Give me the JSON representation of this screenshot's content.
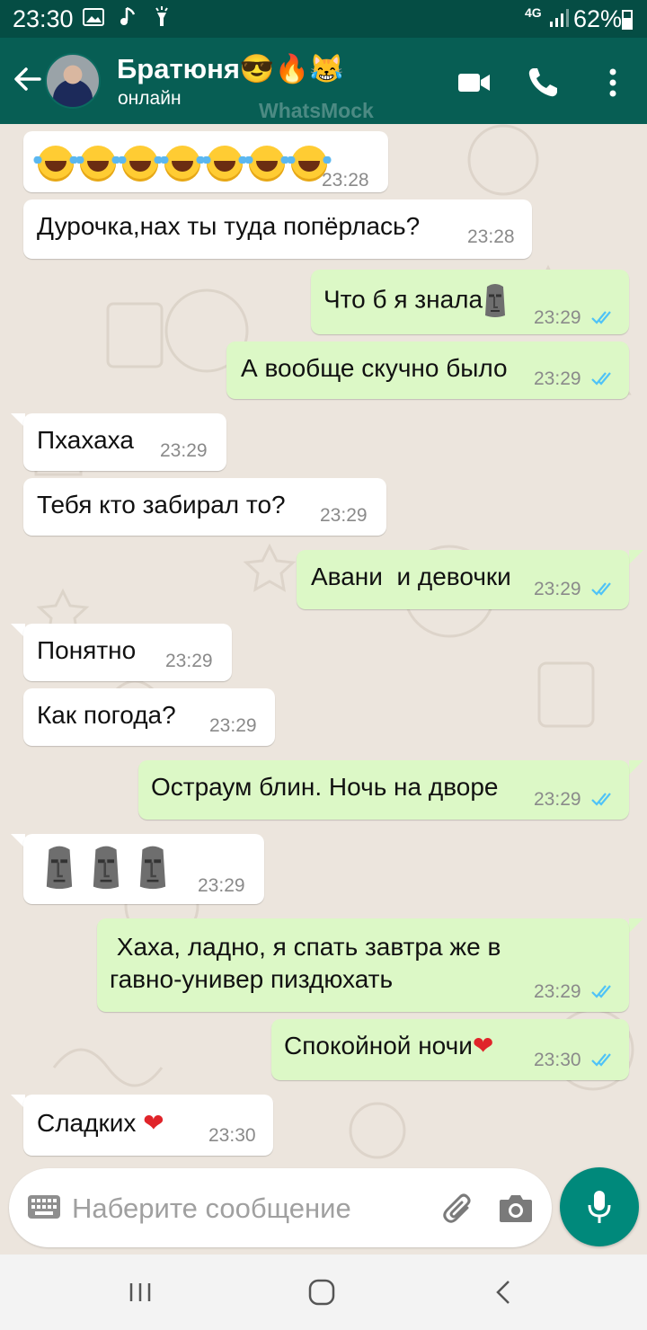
{
  "status_bar": {
    "time": "23:30",
    "network": "4G",
    "battery": "62%",
    "battery_level": 0.62
  },
  "header": {
    "contact_name": "Братюня😎🔥😹",
    "status": "онлайн",
    "watermark": "WhatsMock",
    "icons": [
      "back-arrow-icon",
      "video-call-icon",
      "phone-icon",
      "more-vert-icon"
    ]
  },
  "messages": [
    {
      "dir": "in",
      "text": "",
      "emoji": "😂😂😂😂😂😂😂",
      "time": "23:28"
    },
    {
      "dir": "in",
      "text": "Дурочка,нах ты туда попёрлась?",
      "time": "23:28"
    },
    {
      "dir": "out",
      "text": "Что б я знала🗿",
      "time": "23:29",
      "read": true
    },
    {
      "dir": "out",
      "text": "А вообще скучно было",
      "time": "23:29",
      "read": true
    },
    {
      "dir": "in",
      "text": "Пхахаха",
      "time": "23:29"
    },
    {
      "dir": "in",
      "text": "Тебя кто забирал то?",
      "time": "23:29"
    },
    {
      "dir": "out",
      "text": "Авани  и девочки",
      "time": "23:29",
      "read": true
    },
    {
      "dir": "in",
      "text": "Понятно",
      "time": "23:29"
    },
    {
      "dir": "in",
      "text": "Как погода?",
      "time": "23:29"
    },
    {
      "dir": "out",
      "text": "Остраум блин. Ночь на дворе",
      "time": "23:29",
      "read": true
    },
    {
      "dir": "in",
      "text": "",
      "emoji": "🗿🗿🗿",
      "time": "23:29"
    },
    {
      "dir": "out",
      "text": " Хаха, ладно, я спать завтра же в\nгавно-универ пиздюхать",
      "time": "23:29",
      "read": true
    },
    {
      "dir": "out",
      "text": "Спокойной ночи❤️",
      "time": "23:30",
      "read": true
    },
    {
      "dir": "in",
      "text": "Сладких ❤️",
      "time": "23:30"
    }
  ],
  "composer": {
    "placeholder": "Наберите сообщение",
    "value": "",
    "icons": [
      "keyboard-icon",
      "attach-icon",
      "camera-icon",
      "mic-icon"
    ]
  },
  "colors": {
    "header": "#075E54",
    "status_bar": "#054D44",
    "outgoing_bubble": "#DCF8C6",
    "incoming_bubble": "#FFFFFF",
    "chat_bg": "#ECE5DD",
    "read_ticks": "#4FC3F7",
    "mic_button": "#00897B"
  }
}
